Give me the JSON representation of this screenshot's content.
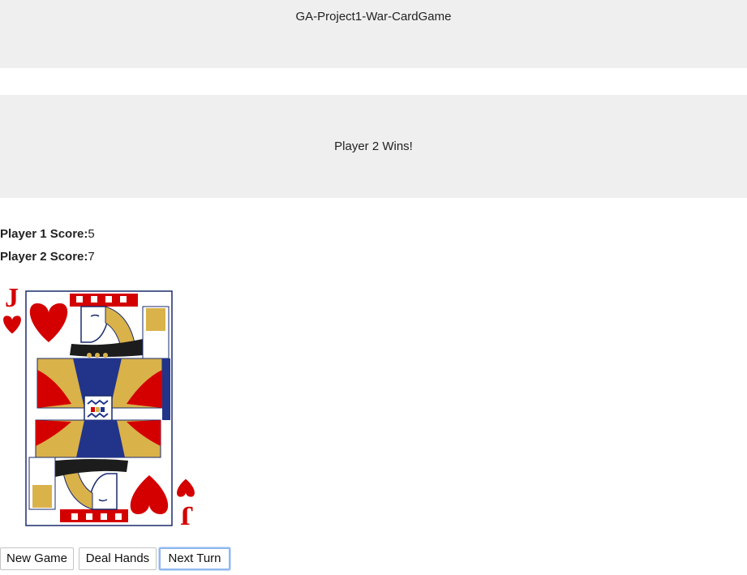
{
  "header": {
    "title": "GA-Project1-War-CardGame"
  },
  "result": {
    "message": "Player 2 Wins!"
  },
  "scores": {
    "player1": {
      "label": "Player 1 Score:",
      "value": "5"
    },
    "player2": {
      "label": "Player 2 Score:",
      "value": "7"
    }
  },
  "card": {
    "rank": "J",
    "suit": "hearts",
    "suit_symbol": "♥",
    "face": "jack",
    "color": "#d40000"
  },
  "controls": {
    "new_game": "New Game",
    "deal_hands": "Deal Hands",
    "next_turn": "Next Turn"
  }
}
